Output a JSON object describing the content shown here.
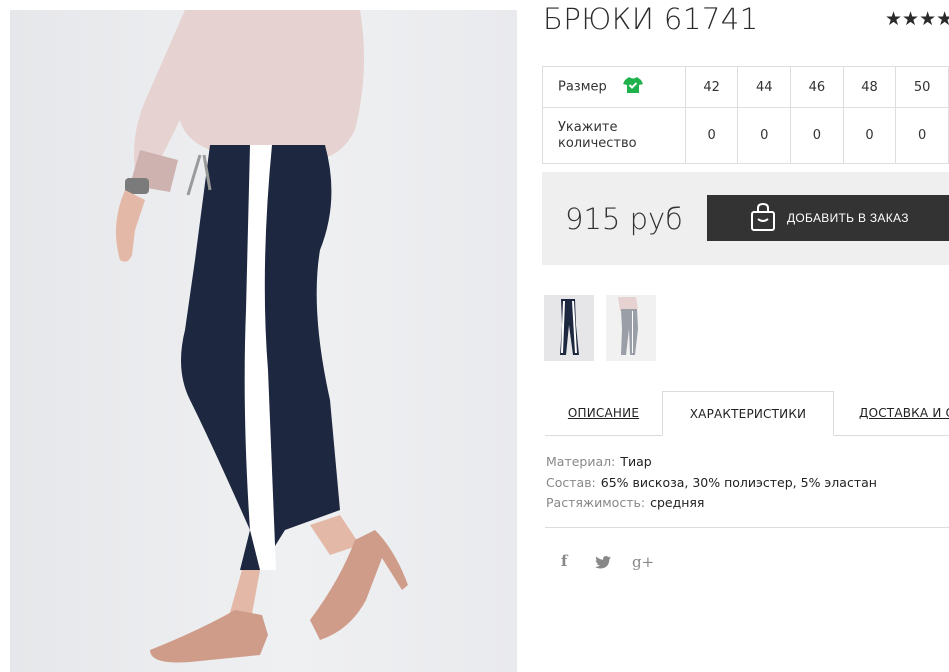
{
  "product": {
    "title": "БРЮКИ 61741",
    "rating_stars": "★★★★"
  },
  "size_table": {
    "size_label": "Размер",
    "qty_label": "Укажите количество",
    "sizes": [
      "42",
      "44",
      "46",
      "48",
      "50"
    ],
    "quantities": [
      "0",
      "0",
      "0",
      "0",
      "0"
    ]
  },
  "purchase": {
    "price": "915 руб",
    "add_button": "ДОБАВИТЬ В ЗАКАЗ"
  },
  "tabs": {
    "description": "ОПИСАНИЕ",
    "characteristics": "ХАРАКТЕРИСТИКИ",
    "delivery": "ДОСТАВКА И ОПЛАТА"
  },
  "specs": [
    {
      "key": "Материал:",
      "value": "Тиар"
    },
    {
      "key": "Состав:",
      "value": "65% вискоза, 30% полиэстер, 5% эластан"
    },
    {
      "key": "Растяжимость:",
      "value": "средняя"
    }
  ],
  "social": {
    "facebook": "f",
    "twitter": "twitter-icon",
    "google": "g+"
  },
  "colors": {
    "button_bg": "#333333",
    "price_block_bg": "#efefef",
    "shirt_icon": "#1fb14b",
    "trousers": "#1d2740",
    "stripe": "#ffffff",
    "shoes": "#cf9c8a",
    "sweater": "#e6d3d1"
  },
  "icons": [
    "shirt-icon",
    "bag-icon",
    "facebook-icon",
    "twitter-icon",
    "google-plus-icon"
  ]
}
